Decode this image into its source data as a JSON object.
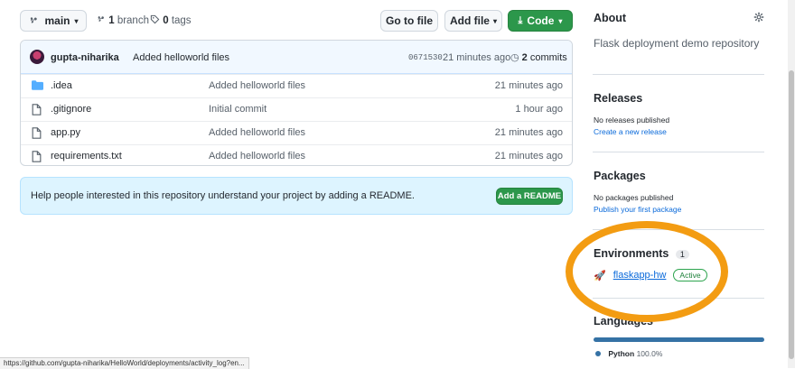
{
  "branch_bar": {
    "branch_name": "main",
    "branch_count": "1",
    "branch_label": "branch",
    "tag_count": "0",
    "tag_label": "tags",
    "go_to_file": "Go to file",
    "add_file": "Add file",
    "code": "Code"
  },
  "commit": {
    "author": "gupta-niharika",
    "message": "Added helloworld files",
    "sha": "0671530",
    "age": "21 minutes ago",
    "commit_count": "2",
    "commit_label": "commits"
  },
  "files": [
    {
      "name": ".idea",
      "type": "folder",
      "message": "Added helloworld files",
      "age": "21 minutes ago"
    },
    {
      "name": ".gitignore",
      "type": "file",
      "message": "Initial commit",
      "age": "1 hour ago"
    },
    {
      "name": "app.py",
      "type": "file",
      "message": "Added helloworld files",
      "age": "21 minutes ago"
    },
    {
      "name": "requirements.txt",
      "type": "file",
      "message": "Added helloworld files",
      "age": "21 minutes ago"
    }
  ],
  "readme_banner": {
    "text": "Help people interested in this repository understand your project by adding a README.",
    "button": "Add a README"
  },
  "sidebar": {
    "about_title": "About",
    "about_description": "Flask deployment demo repository",
    "releases_title": "Releases",
    "releases_empty": "No releases published",
    "releases_link": "Create a new release",
    "packages_title": "Packages",
    "packages_empty": "No packages published",
    "packages_link": "Publish your first package",
    "environments_title": "Environments",
    "environments_count": "1",
    "environment_name": "flaskapp-hw",
    "environment_status": "Active",
    "languages_title": "Languages",
    "language_name": "Python",
    "language_percent": "100.0%",
    "language_fraction": 1.0
  },
  "status_bar_url": "https://github.com/gupta-niharika/HelloWorld/deployments/activity_log?en...",
  "colors": {
    "accent_green": "#2c974b",
    "link_blue": "#0969da",
    "annotation_orange": "#f39c12",
    "python_blue": "#3572A5"
  }
}
